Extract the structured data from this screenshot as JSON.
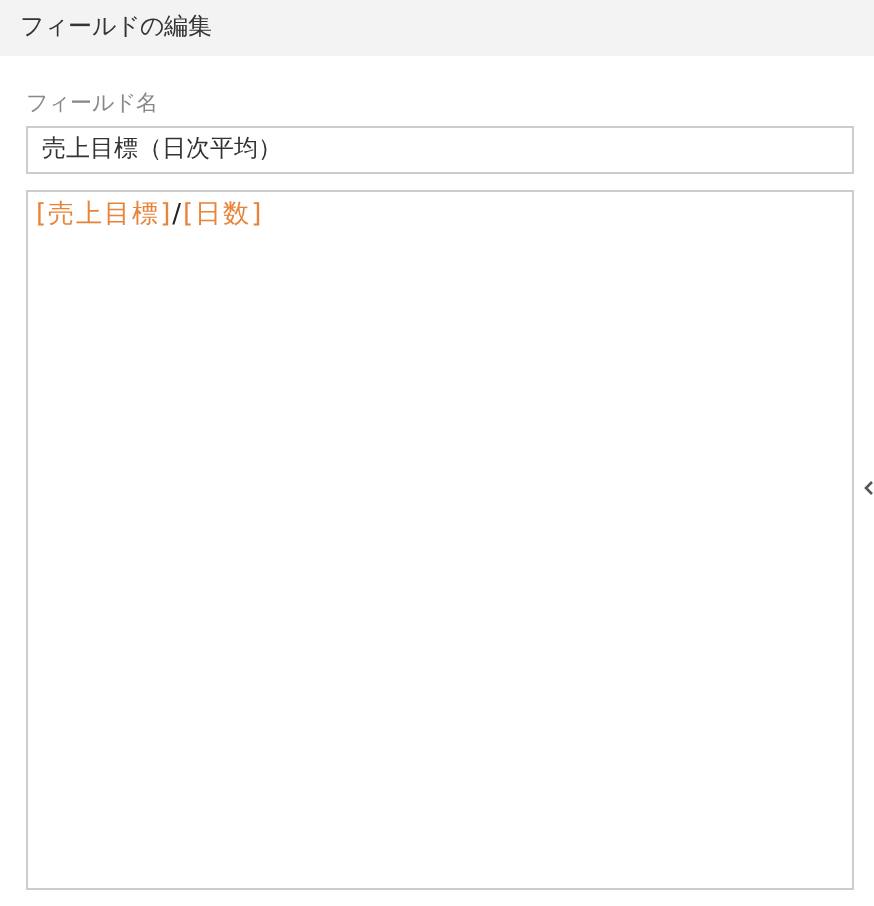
{
  "header": {
    "title": "フィールドの編集"
  },
  "name_field": {
    "label": "フィールド名",
    "value": "売上目標（日次平均）"
  },
  "formula": [
    {
      "kind": "field",
      "text": "[売上目標]"
    },
    {
      "kind": "operator",
      "text": "/"
    },
    {
      "kind": "field",
      "text": "[日数]"
    }
  ]
}
